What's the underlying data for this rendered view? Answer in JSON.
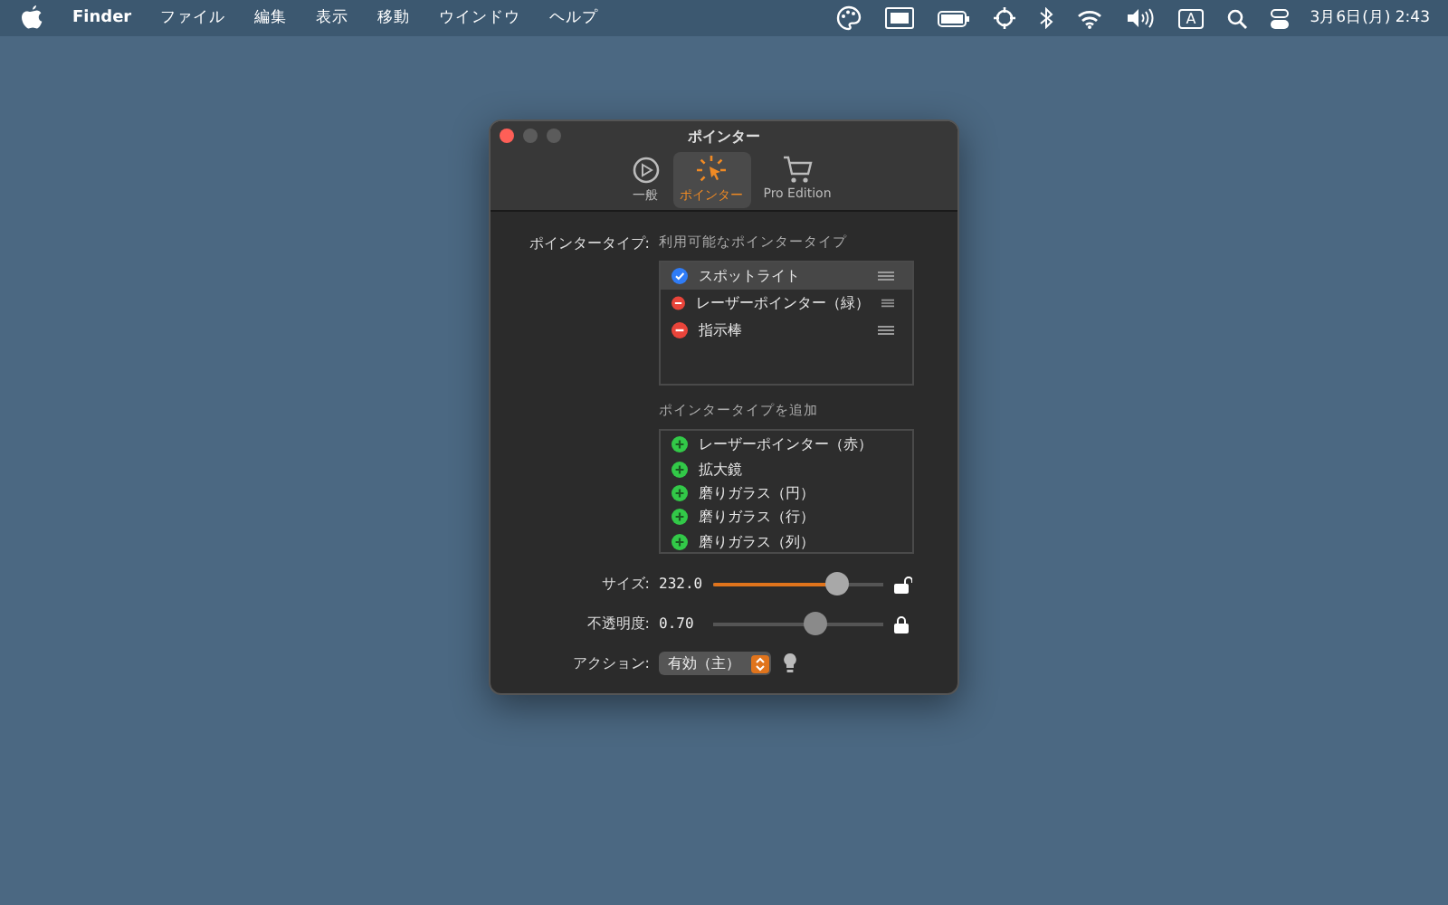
{
  "menu_bar": {
    "app_name": "Finder",
    "menus": [
      "ファイル",
      "編集",
      "表示",
      "移動",
      "ウインドウ",
      "ヘルプ"
    ],
    "input_indicator": "A",
    "clock": "3月6日(月)  2:43"
  },
  "window": {
    "title": "ポインター",
    "toolbar": [
      {
        "kind": "general",
        "label": "一般",
        "selected": false
      },
      {
        "kind": "pointer",
        "label": "ポインター",
        "selected": true
      },
      {
        "kind": "cart",
        "label": "Pro Edition",
        "selected": false
      }
    ],
    "pointer_type_label": "ポインタータイプ:",
    "available_heading": "利用可能なポインタータイプ",
    "available": [
      {
        "kind": "check",
        "label": "スポットライト",
        "selected": true
      },
      {
        "kind": "remove",
        "label": "レーザーポインター（緑）",
        "selected": false
      },
      {
        "kind": "remove",
        "label": "指示棒",
        "selected": false
      }
    ],
    "add_heading": "ポインタータイプを追加",
    "addable": [
      "レーザーポインター（赤）",
      "拡大鏡",
      "磨りガラス（円）",
      "磨りガラス（行）",
      "磨りガラス（列）"
    ],
    "sliders": [
      {
        "label": "サイズ:",
        "reading": "232.0",
        "level": 0.72,
        "locked": false
      },
      {
        "label": "不透明度:",
        "reading": "0.70",
        "level": 0.6,
        "locked": true
      }
    ],
    "action_label": "アクション:",
    "action_value": "有効（主）"
  }
}
